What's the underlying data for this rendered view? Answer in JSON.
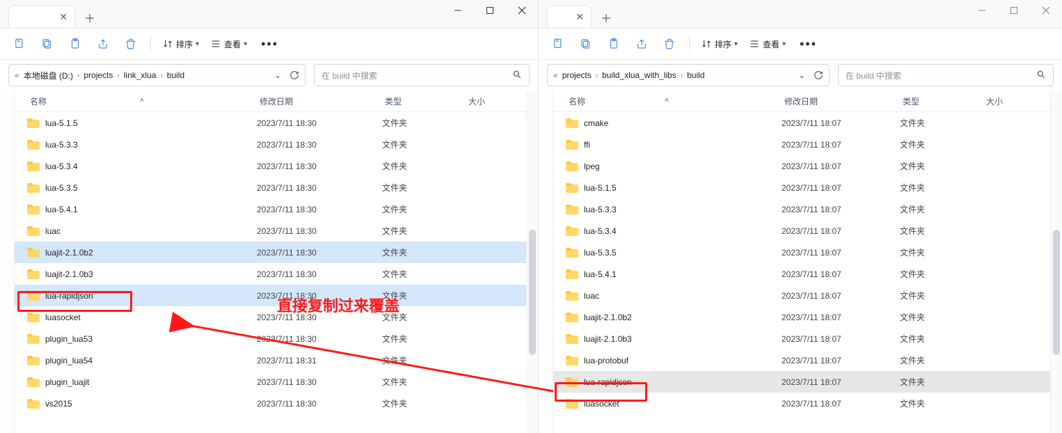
{
  "left": {
    "toolbar": {
      "sort": "排序",
      "view": "查看"
    },
    "breadcrumb": [
      "本地磁盘 (D:)",
      "projects",
      "link_xlua",
      "build"
    ],
    "search_placeholder": "在 build 中搜索",
    "columns": {
      "name": "名称",
      "date": "修改日期",
      "type": "类型",
      "size": "大小"
    },
    "rows": [
      {
        "name": "lua-5.1.5",
        "date": "2023/7/11 18:30",
        "type": "文件夹"
      },
      {
        "name": "lua-5.3.3",
        "date": "2023/7/11 18:30",
        "type": "文件夹"
      },
      {
        "name": "lua-5.3.4",
        "date": "2023/7/11 18:30",
        "type": "文件夹"
      },
      {
        "name": "lua-5.3.5",
        "date": "2023/7/11 18:30",
        "type": "文件夹"
      },
      {
        "name": "lua-5.4.1",
        "date": "2023/7/11 18:30",
        "type": "文件夹"
      },
      {
        "name": "luac",
        "date": "2023/7/11 18:30",
        "type": "文件夹"
      },
      {
        "name": "luajit-2.1.0b2",
        "date": "2023/7/11 18:30",
        "type": "文件夹",
        "highlight": true
      },
      {
        "name": "luajit-2.1.0b3",
        "date": "2023/7/11 18:30",
        "type": "文件夹"
      },
      {
        "name": "lua-rapidjson",
        "date": "2023/7/11 18:30",
        "type": "文件夹",
        "highlight": true
      },
      {
        "name": "luasocket",
        "date": "2023/7/11 18:30",
        "type": "文件夹"
      },
      {
        "name": "plugin_lua53",
        "date": "2023/7/11 18:30",
        "type": "文件夹"
      },
      {
        "name": "plugin_lua54",
        "date": "2023/7/11 18:31",
        "type": "文件夹"
      },
      {
        "name": "plugin_luajit",
        "date": "2023/7/11 18:30",
        "type": "文件夹"
      },
      {
        "name": "vs2015",
        "date": "2023/7/11 18:30",
        "type": "文件夹"
      }
    ]
  },
  "right": {
    "toolbar": {
      "sort": "排序",
      "view": "查看"
    },
    "breadcrumb": [
      "projects",
      "build_xlua_with_libs",
      "build"
    ],
    "search_placeholder": "在 build 中搜索",
    "columns": {
      "name": "名称",
      "date": "修改日期",
      "type": "类型",
      "size": "大小"
    },
    "rows": [
      {
        "name": "cmake",
        "date": "2023/7/11 18:07",
        "type": "文件夹"
      },
      {
        "name": "ffi",
        "date": "2023/7/11 18:07",
        "type": "文件夹"
      },
      {
        "name": "lpeg",
        "date": "2023/7/11 18:07",
        "type": "文件夹"
      },
      {
        "name": "lua-5.1.5",
        "date": "2023/7/11 18:07",
        "type": "文件夹"
      },
      {
        "name": "lua-5.3.3",
        "date": "2023/7/11 18:07",
        "type": "文件夹"
      },
      {
        "name": "lua-5.3.4",
        "date": "2023/7/11 18:07",
        "type": "文件夹"
      },
      {
        "name": "lua-5.3.5",
        "date": "2023/7/11 18:07",
        "type": "文件夹"
      },
      {
        "name": "lua-5.4.1",
        "date": "2023/7/11 18:07",
        "type": "文件夹"
      },
      {
        "name": "luac",
        "date": "2023/7/11 18:07",
        "type": "文件夹"
      },
      {
        "name": "luajit-2.1.0b2",
        "date": "2023/7/11 18:07",
        "type": "文件夹"
      },
      {
        "name": "luajit-2.1.0b3",
        "date": "2023/7/11 18:07",
        "type": "文件夹"
      },
      {
        "name": "lua-protobuf",
        "date": "2023/7/11 18:07",
        "type": "文件夹"
      },
      {
        "name": "lua-rapidjson",
        "date": "2023/7/11 18:07",
        "type": "文件夹",
        "selected": true
      },
      {
        "name": "luasocket",
        "date": "2023/7/11 18:07",
        "type": "文件夹"
      }
    ]
  },
  "annotation": {
    "text": "直接复制过来覆盖"
  }
}
